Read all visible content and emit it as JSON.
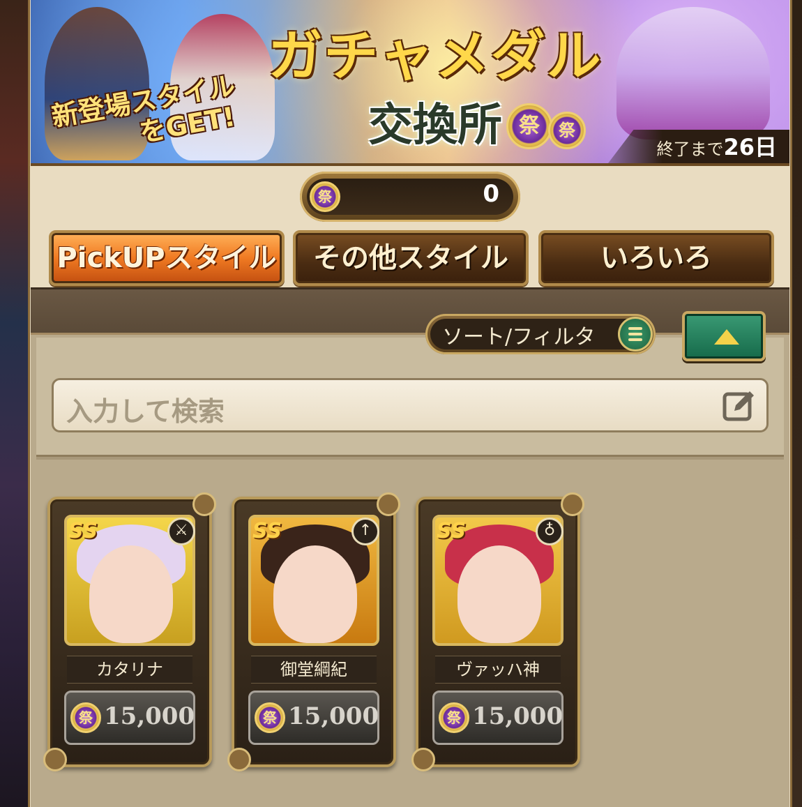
{
  "banner": {
    "title": "ガチャメダル",
    "subtitle": "交換所",
    "new_line1": "新登場スタイル",
    "new_line2": "をGET!",
    "end_label": "終了まで",
    "end_days": "26日",
    "medal_glyph": "祭"
  },
  "medal_counter": {
    "value": "0",
    "medal_glyph": "祭"
  },
  "tabs": [
    {
      "label": "PickUPスタイル",
      "active": true
    },
    {
      "label": "その他スタイル",
      "active": false
    },
    {
      "label": "いろいろ",
      "active": false
    }
  ],
  "filter": {
    "sort_label": "ソート/フィルタ",
    "search_placeholder": "入力して検索"
  },
  "cards": [
    {
      "name": "カタリナ",
      "price": "15,000",
      "rank": "SS",
      "weapon_icon": "sword-icon",
      "weapon_glyph": "⚔",
      "hair_color": "#e4d4f0"
    },
    {
      "name": "御堂綱紀",
      "price": "15,000",
      "rank": "SS",
      "weapon_icon": "katana-icon",
      "weapon_glyph": "↑",
      "hair_color": "#3a241a"
    },
    {
      "name": "ヴァッハ神",
      "price": "15,000",
      "rank": "SS",
      "weapon_icon": "staff-icon",
      "weapon_glyph": "♁",
      "hair_color": "#c8304a"
    }
  ],
  "colors": {
    "active_tab": "#f07a22",
    "inactive_tab": "#4a2c12",
    "collapse_button": "#166a4a",
    "title_gold": "#ffd84a"
  }
}
